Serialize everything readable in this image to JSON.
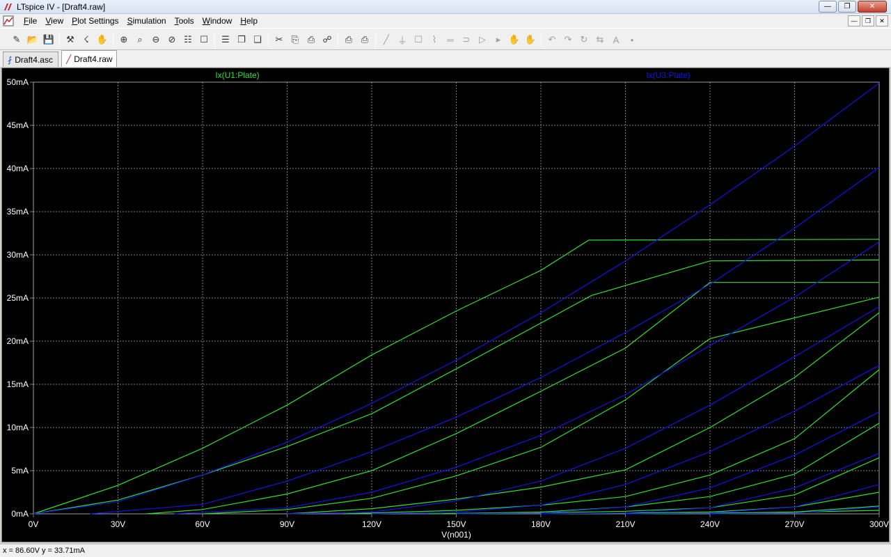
{
  "window": {
    "title": "LTspice IV - [Draft4.raw]",
    "buttons": [
      "minimize",
      "maximize",
      "close"
    ]
  },
  "menu": [
    {
      "label": "File",
      "hotkey": "F",
      "rest": "ile"
    },
    {
      "label": "View",
      "hotkey": "V",
      "rest": "iew"
    },
    {
      "label": "Plot Settings",
      "hotkey": "P",
      "rest": "lot Settings"
    },
    {
      "label": "Simulation",
      "hotkey": "S",
      "rest": "imulation"
    },
    {
      "label": "Tools",
      "hotkey": "T",
      "rest": "ools"
    },
    {
      "label": "Window",
      "hotkey": "W",
      "rest": "indow"
    },
    {
      "label": "Help",
      "hotkey": "H",
      "rest": "elp"
    }
  ],
  "toolbar": {
    "icons": [
      "new-schematic-icon",
      "open-icon",
      "save-icon",
      "control-panel-icon",
      "run-icon",
      "halt-icon",
      "zoom-in-icon",
      "zoom-area-icon",
      "zoom-out-icon",
      "zoom-cancel-icon",
      "autorange-icon",
      "mark-unused-icon",
      "tile-horizontal-icon",
      "cascade-icon",
      "tile-vertical-icon",
      "cut-icon",
      "copy-icon",
      "paste-icon",
      "find-icon",
      "print-preview-icon",
      "print-icon",
      "wire-icon",
      "ground-icon",
      "label-icon",
      "resistor-icon",
      "capacitor-icon",
      "inductor-icon",
      "diode-icon",
      "component-icon",
      "move-icon",
      "drag-icon",
      "undo-icon",
      "redo-icon",
      "rotate-icon",
      "mirror-icon",
      "text-icon",
      "spice-directive-icon"
    ]
  },
  "tabs": [
    {
      "label": "Draft4.asc",
      "icon": "schematic-icon",
      "active": false
    },
    {
      "label": "Draft4.raw",
      "icon": "waveform-icon",
      "active": true
    }
  ],
  "status": {
    "readout": "x = 86.60V   y = 33.71mA"
  },
  "colors": {
    "background": "#000000",
    "grid": "#808080",
    "axis_text": "#ffffff",
    "u1": "#2ee02e",
    "u3": "#1414e6"
  },
  "chart_data": {
    "type": "line",
    "xlabel": "V(n001)",
    "ylabel": "",
    "xlim": [
      0,
      300
    ],
    "ylim": [
      0,
      50
    ],
    "x_ticks": [
      "0V",
      "30V",
      "60V",
      "90V",
      "120V",
      "150V",
      "180V",
      "210V",
      "240V",
      "270V",
      "300V"
    ],
    "y_ticks": [
      "0mA",
      "5mA",
      "10mA",
      "15mA",
      "20mA",
      "25mA",
      "30mA",
      "35mA",
      "40mA",
      "45mA",
      "50mA"
    ],
    "grid": true,
    "legend": [
      {
        "name": "Ix(U1:Plate)",
        "color": "#2ee02e"
      },
      {
        "name": "Ix(U3:Plate)",
        "color": "#1414e6"
      }
    ],
    "series": [
      {
        "name": "Ix(U1:Plate)",
        "color": "#2ee02e",
        "points": [
          [
            0,
            0
          ],
          [
            30,
            3.3
          ],
          [
            60,
            7.6
          ],
          [
            90,
            12.6
          ],
          [
            120,
            18.4
          ],
          [
            150,
            23.5
          ],
          [
            180,
            28.2
          ],
          [
            197,
            31.7
          ],
          [
            300,
            31.8
          ]
        ]
      },
      {
        "name": "Ix(U1:Plate)",
        "color": "#2ee02e",
        "points": [
          [
            0,
            0
          ],
          [
            30,
            1.6
          ],
          [
            60,
            4.5
          ],
          [
            90,
            7.8
          ],
          [
            120,
            11.6
          ],
          [
            150,
            16.8
          ],
          [
            180,
            22.1
          ],
          [
            198,
            25.3
          ],
          [
            240,
            29.3
          ],
          [
            300,
            29.4
          ]
        ]
      },
      {
        "name": "Ix(U1:Plate)",
        "color": "#2ee02e",
        "points": [
          [
            40,
            0
          ],
          [
            60,
            0.5
          ],
          [
            90,
            2.3
          ],
          [
            120,
            5.0
          ],
          [
            150,
            9.3
          ],
          [
            180,
            14.2
          ],
          [
            210,
            19.2
          ],
          [
            240,
            26.8
          ],
          [
            300,
            26.8
          ]
        ]
      },
      {
        "name": "Ix(U1:Plate)",
        "color": "#2ee02e",
        "points": [
          [
            60,
            0
          ],
          [
            90,
            0.5
          ],
          [
            120,
            1.8
          ],
          [
            150,
            4.4
          ],
          [
            180,
            7.7
          ],
          [
            210,
            13.2
          ],
          [
            240,
            20.3
          ],
          [
            270,
            22.7
          ],
          [
            300,
            25.1
          ]
        ]
      },
      {
        "name": "Ix(U1:Plate)",
        "color": "#2ee02e",
        "points": [
          [
            90,
            0
          ],
          [
            120,
            0.6
          ],
          [
            150,
            1.7
          ],
          [
            180,
            3.1
          ],
          [
            210,
            5.1
          ],
          [
            240,
            10.0
          ],
          [
            270,
            15.8
          ],
          [
            300,
            23.3
          ]
        ]
      },
      {
        "name": "Ix(U1:Plate)",
        "color": "#2ee02e",
        "points": [
          [
            110,
            0
          ],
          [
            150,
            0.4
          ],
          [
            180,
            1.0
          ],
          [
            210,
            2.0
          ],
          [
            240,
            4.5
          ],
          [
            270,
            8.7
          ],
          [
            300,
            16.7
          ]
        ]
      },
      {
        "name": "Ix(U1:Plate)",
        "color": "#2ee02e",
        "points": [
          [
            140,
            0
          ],
          [
            180,
            0.2
          ],
          [
            210,
            0.8
          ],
          [
            240,
            2.0
          ],
          [
            270,
            4.6
          ],
          [
            300,
            10.5
          ]
        ]
      },
      {
        "name": "Ix(U1:Plate)",
        "color": "#2ee02e",
        "points": [
          [
            160,
            0
          ],
          [
            210,
            0.3
          ],
          [
            240,
            0.7
          ],
          [
            270,
            2.2
          ],
          [
            300,
            6.5
          ]
        ]
      },
      {
        "name": "Ix(U1:Plate)",
        "color": "#2ee02e",
        "points": [
          [
            190,
            0
          ],
          [
            240,
            0.2
          ],
          [
            270,
            0.8
          ],
          [
            300,
            2.5
          ]
        ]
      },
      {
        "name": "Ix(U1:Plate)",
        "color": "#2ee02e",
        "points": [
          [
            220,
            0
          ],
          [
            270,
            0.2
          ],
          [
            300,
            0.9
          ]
        ]
      },
      {
        "name": "Ix(U1:Plate)",
        "color": "#2ee02e",
        "points": [
          [
            240,
            0
          ],
          [
            300,
            0.4
          ]
        ]
      },
      {
        "name": "Ix(U3:Plate)",
        "color": "#1414e6",
        "points": [
          [
            0,
            0
          ],
          [
            30,
            1.4
          ],
          [
            60,
            4.5
          ],
          [
            90,
            8.3
          ],
          [
            120,
            12.8
          ],
          [
            150,
            17.8
          ],
          [
            180,
            23.3
          ],
          [
            210,
            29.3
          ],
          [
            240,
            35.8
          ],
          [
            270,
            42.6
          ],
          [
            300,
            49.9
          ]
        ]
      },
      {
        "name": "Ix(U3:Plate)",
        "color": "#1414e6",
        "points": [
          [
            20,
            0
          ],
          [
            60,
            1.1
          ],
          [
            90,
            3.8
          ],
          [
            120,
            7.2
          ],
          [
            150,
            11.2
          ],
          [
            180,
            15.8
          ],
          [
            210,
            21.0
          ],
          [
            240,
            26.6
          ],
          [
            270,
            33.1
          ],
          [
            300,
            40.1
          ]
        ]
      },
      {
        "name": "Ix(U3:Plate)",
        "color": "#1414e6",
        "points": [
          [
            50,
            0
          ],
          [
            90,
            0.7
          ],
          [
            120,
            2.5
          ],
          [
            150,
            5.4
          ],
          [
            180,
            9.1
          ],
          [
            210,
            13.8
          ],
          [
            240,
            19.5
          ],
          [
            270,
            25.1
          ],
          [
            300,
            31.5
          ]
        ]
      },
      {
        "name": "Ix(U3:Plate)",
        "color": "#1414e6",
        "points": [
          [
            90,
            0
          ],
          [
            120,
            0.2
          ],
          [
            150,
            1.5
          ],
          [
            180,
            3.8
          ],
          [
            210,
            7.6
          ],
          [
            240,
            12.6
          ],
          [
            270,
            18.2
          ],
          [
            300,
            24.0
          ]
        ]
      },
      {
        "name": "Ix(U3:Plate)",
        "color": "#1414e6",
        "points": [
          [
            120,
            0
          ],
          [
            150,
            0.2
          ],
          [
            180,
            1.0
          ],
          [
            210,
            3.4
          ],
          [
            240,
            7.2
          ],
          [
            270,
            11.9
          ],
          [
            300,
            17.2
          ]
        ]
      },
      {
        "name": "Ix(U3:Plate)",
        "color": "#1414e6",
        "points": [
          [
            150,
            0
          ],
          [
            180,
            0.1
          ],
          [
            210,
            0.8
          ],
          [
            240,
            3.0
          ],
          [
            270,
            6.8
          ],
          [
            300,
            11.8
          ]
        ]
      },
      {
        "name": "Ix(U3:Plate)",
        "color": "#1414e6",
        "points": [
          [
            180,
            0
          ],
          [
            210,
            0.1
          ],
          [
            240,
            0.7
          ],
          [
            270,
            3.0
          ],
          [
            300,
            7.0
          ]
        ]
      },
      {
        "name": "Ix(U3:Plate)",
        "color": "#1414e6",
        "points": [
          [
            210,
            0
          ],
          [
            240,
            0.1
          ],
          [
            270,
            0.8
          ],
          [
            300,
            3.4
          ]
        ]
      },
      {
        "name": "Ix(U3:Plate)",
        "color": "#1414e6",
        "points": [
          [
            240,
            0
          ],
          [
            270,
            0.1
          ],
          [
            300,
            0.8
          ]
        ]
      }
    ]
  }
}
